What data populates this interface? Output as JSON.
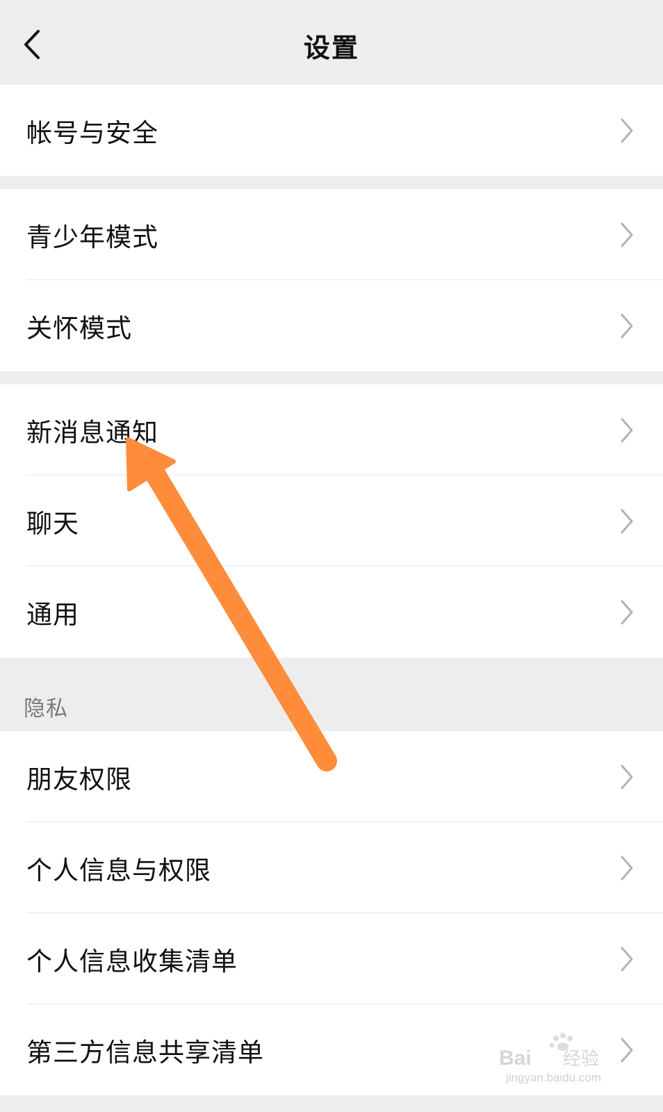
{
  "header": {
    "title": "设置",
    "back_icon": "chevron-left-icon"
  },
  "groups": [
    {
      "items": [
        {
          "label": "帐号与安全"
        }
      ]
    },
    {
      "items": [
        {
          "label": "青少年模式"
        },
        {
          "label": "关怀模式"
        }
      ]
    },
    {
      "items": [
        {
          "label": "新消息通知"
        },
        {
          "label": "聊天"
        },
        {
          "label": "通用"
        }
      ]
    }
  ],
  "privacy": {
    "section_label": "隐私",
    "items": [
      {
        "label": "朋友权限"
      },
      {
        "label": "个人信息与权限"
      },
      {
        "label": "个人信息收集清单"
      },
      {
        "label": "第三方信息共享清单"
      }
    ]
  },
  "watermark": {
    "brand": "Bai",
    "brand_suffix": "经验",
    "url": "jingyan.baidu.com"
  },
  "colors": {
    "background": "#ededed",
    "row_background": "#ffffff",
    "arrow": "#ff8c3b",
    "chevron": "#b2b2b2"
  }
}
